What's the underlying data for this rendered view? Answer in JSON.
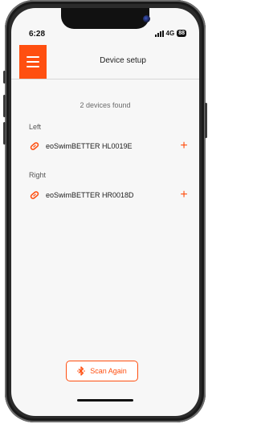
{
  "status_bar": {
    "time": "6:28",
    "network": "4G",
    "battery": "88"
  },
  "header": {
    "title": "Device setup",
    "menu_icon": "hamburger-menu-icon"
  },
  "scan_result": {
    "summary": "2 devices found"
  },
  "sections": [
    {
      "label": "Left",
      "devices": [
        {
          "name": "eoSwimBETTER HL0019E",
          "icon": "paddle-device-icon",
          "action": "+"
        }
      ]
    },
    {
      "label": "Right",
      "devices": [
        {
          "name": "eoSwimBETTER HR0018D",
          "icon": "paddle-device-icon",
          "action": "+"
        }
      ]
    }
  ],
  "footer": {
    "scan_again_label": "Scan Again",
    "scan_icon": "bluetooth-icon"
  },
  "colors": {
    "accent": "#ff4f10",
    "background": "#f7f7f7",
    "text": "#1d1d1d",
    "muted": "#6b6b6b"
  }
}
